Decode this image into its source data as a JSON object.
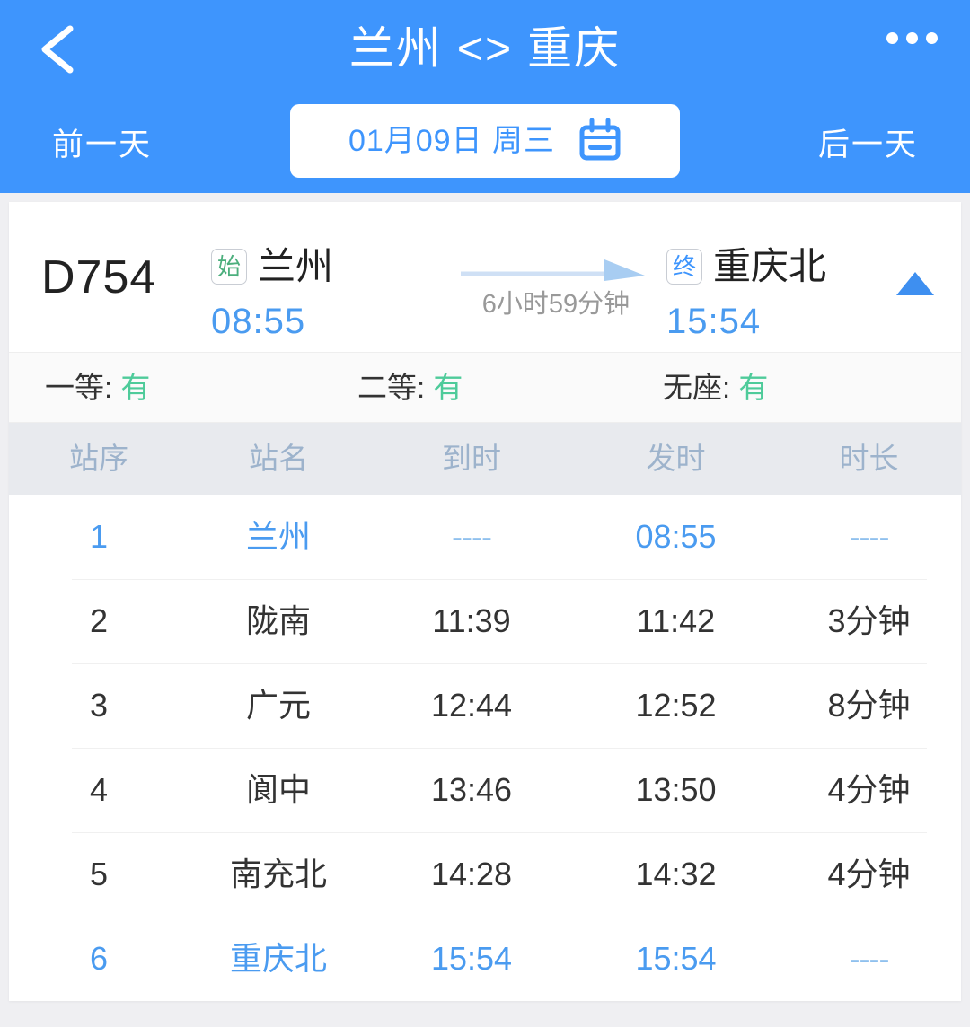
{
  "header": {
    "title": "兰州 <> 重庆",
    "back_icon": "chevron-left-icon",
    "more_icon": "more-dots-icon",
    "prev_day": "前一天",
    "next_day": "后一天",
    "date": "01月09日 周三",
    "calendar_icon": "calendar-icon",
    "accent_color": "#3e95fd"
  },
  "train": {
    "number": "D754",
    "from": {
      "badge": "始",
      "station": "兰州",
      "time": "08:55",
      "badge_color": "#4caf7d"
    },
    "to": {
      "badge": "终",
      "station": "重庆北",
      "time": "15:54",
      "badge_color": "#3e95fd"
    },
    "duration": "6小时59分钟",
    "collapse_icon": "triangle-up-icon"
  },
  "seats": [
    {
      "label": "一等:",
      "value": "有"
    },
    {
      "label": "二等:",
      "value": "有"
    },
    {
      "label": "无座:",
      "value": "有"
    }
  ],
  "seat_available_color": "#4ecb9a",
  "table": {
    "columns": [
      "站序",
      "站名",
      "到时",
      "发时",
      "时长"
    ],
    "rows": [
      {
        "seq": "1",
        "name": "兰州",
        "arrive": "----",
        "depart": "08:55",
        "stop": "----",
        "highlight": true
      },
      {
        "seq": "2",
        "name": "陇南",
        "arrive": "11:39",
        "depart": "11:42",
        "stop": "3分钟",
        "highlight": false
      },
      {
        "seq": "3",
        "name": "广元",
        "arrive": "12:44",
        "depart": "12:52",
        "stop": "8分钟",
        "highlight": false
      },
      {
        "seq": "4",
        "name": "阆中",
        "arrive": "13:46",
        "depart": "13:50",
        "stop": "4分钟",
        "highlight": false
      },
      {
        "seq": "5",
        "name": "南充北",
        "arrive": "14:28",
        "depart": "14:32",
        "stop": "4分钟",
        "highlight": false
      },
      {
        "seq": "6",
        "name": "重庆北",
        "arrive": "15:54",
        "depart": "15:54",
        "stop": "----",
        "highlight": true
      }
    ]
  }
}
